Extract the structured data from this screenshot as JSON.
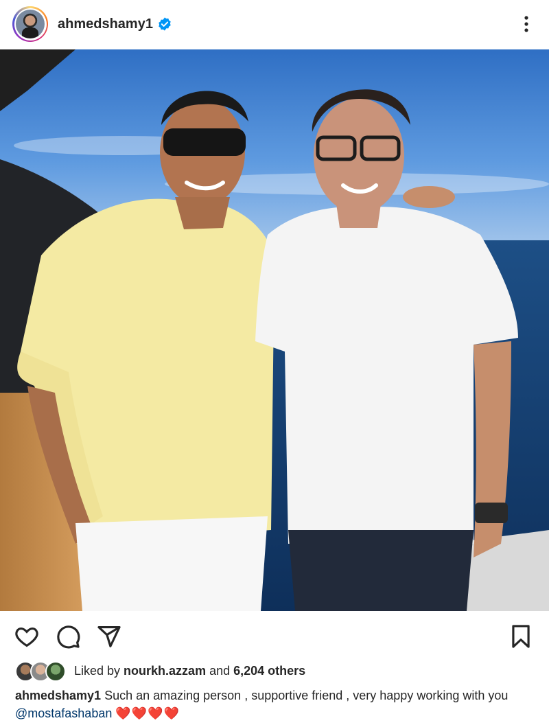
{
  "post": {
    "username": "ahmedshamy1",
    "verified": true,
    "image_alt": "Two men standing on a yacht deck with blue sea and sky behind them"
  },
  "icons": {
    "like": "heart-outline-icon",
    "comment": "comment-bubble-icon",
    "share": "paper-plane-icon",
    "save": "bookmark-icon",
    "more": "more-vertical-icon",
    "verified": "verified-badge-icon"
  },
  "likes": {
    "prefix": "Liked by ",
    "user": "nourkh.azzam",
    "and": " and ",
    "count": "6,204 others"
  },
  "caption": {
    "user": "ahmedshamy1",
    "text": " Such an amazing person , supportive friend , very happy working with you ",
    "mention": "@mostafashaban",
    "emoji": "❤️❤️❤️❤️"
  },
  "colors": {
    "verified_blue": "#0095f6",
    "mention": "#00376b",
    "heart_red": "#e0112a"
  }
}
